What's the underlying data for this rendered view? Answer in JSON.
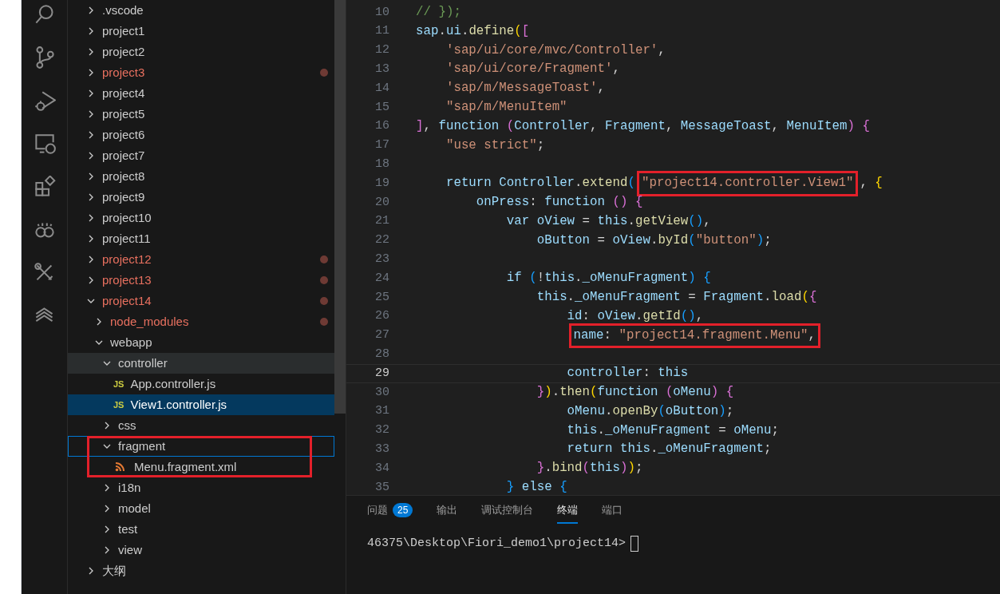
{
  "activity_bar": [
    {
      "kind": "search"
    },
    {
      "kind": "source-control"
    },
    {
      "kind": "run-debug"
    },
    {
      "kind": "remote"
    },
    {
      "kind": "extensions"
    },
    {
      "kind": "loop"
    },
    {
      "kind": "tools"
    },
    {
      "kind": "layers"
    }
  ],
  "explorer": {
    "items": [
      {
        "label": ".vscode",
        "kind": "folder",
        "expanded": false,
        "modified": false,
        "selected": false,
        "hovered": false,
        "focused": false,
        "boxed": false
      },
      {
        "label": "project1",
        "kind": "folder",
        "expanded": false,
        "modified": false,
        "selected": false,
        "hovered": false,
        "focused": false,
        "boxed": false
      },
      {
        "label": "project2",
        "kind": "folder",
        "expanded": false,
        "modified": false,
        "selected": false,
        "hovered": false,
        "focused": false,
        "boxed": false
      },
      {
        "label": "project3",
        "kind": "folder",
        "expanded": false,
        "modified": true,
        "selected": false,
        "hovered": false,
        "focused": false,
        "boxed": false
      },
      {
        "label": "project4",
        "kind": "folder",
        "expanded": false,
        "modified": false,
        "selected": false,
        "hovered": false,
        "focused": false,
        "boxed": false
      },
      {
        "label": "project5",
        "kind": "folder",
        "expanded": false,
        "modified": false,
        "selected": false,
        "hovered": false,
        "focused": false,
        "boxed": false
      },
      {
        "label": "project6",
        "kind": "folder",
        "expanded": false,
        "modified": false,
        "selected": false,
        "hovered": false,
        "focused": false,
        "boxed": false
      },
      {
        "label": "project7",
        "kind": "folder",
        "expanded": false,
        "modified": false,
        "selected": false,
        "hovered": false,
        "focused": false,
        "boxed": false
      },
      {
        "label": "project8",
        "kind": "folder",
        "expanded": false,
        "modified": false,
        "selected": false,
        "hovered": false,
        "focused": false,
        "boxed": false
      },
      {
        "label": "project9",
        "kind": "folder",
        "expanded": false,
        "modified": false,
        "selected": false,
        "hovered": false,
        "focused": false,
        "boxed": false
      },
      {
        "label": "project10",
        "kind": "folder",
        "expanded": false,
        "modified": false,
        "selected": false,
        "hovered": false,
        "focused": false,
        "boxed": false
      },
      {
        "label": "project11",
        "kind": "folder",
        "expanded": false,
        "modified": false,
        "selected": false,
        "hovered": false,
        "focused": false,
        "boxed": false
      },
      {
        "label": "project12",
        "kind": "folder",
        "expanded": false,
        "modified": true,
        "selected": false,
        "hovered": false,
        "focused": false,
        "boxed": false
      },
      {
        "label": "project13",
        "kind": "folder",
        "expanded": false,
        "modified": true,
        "selected": false,
        "hovered": false,
        "focused": false,
        "boxed": false
      },
      {
        "label": "project14",
        "kind": "folder",
        "expanded": true,
        "modified": true,
        "selected": false,
        "hovered": false,
        "focused": false,
        "boxed": false,
        "children": [
          {
            "label": "node_modules",
            "kind": "folder",
            "expanded": false,
            "modified": true,
            "selected": false,
            "hovered": false,
            "focused": false,
            "boxed": false
          },
          {
            "label": "webapp",
            "kind": "folder",
            "expanded": true,
            "modified": false,
            "selected": false,
            "hovered": false,
            "focused": false,
            "boxed": false,
            "children": [
              {
                "label": "controller",
                "kind": "folder",
                "expanded": true,
                "modified": false,
                "selected": false,
                "hovered": true,
                "focused": false,
                "boxed": false,
                "children": [
                  {
                    "label": "App.controller.js",
                    "kind": "js",
                    "icon_text": "JS",
                    "modified": false,
                    "selected": false,
                    "hovered": false,
                    "focused": false,
                    "boxed": false
                  },
                  {
                    "label": "View1.controller.js",
                    "kind": "js",
                    "icon_text": "JS",
                    "modified": false,
                    "selected": true,
                    "hovered": false,
                    "focused": false,
                    "boxed": false
                  }
                ]
              },
              {
                "label": "css",
                "kind": "folder",
                "expanded": false,
                "modified": false,
                "selected": false,
                "hovered": false,
                "focused": false,
                "boxed": false
              },
              {
                "label": "fragment",
                "kind": "folder",
                "expanded": true,
                "modified": false,
                "selected": false,
                "hovered": false,
                "focused": true,
                "boxed": true,
                "children": [
                  {
                    "label": "Menu.fragment.xml",
                    "kind": "xml",
                    "modified": false,
                    "selected": false,
                    "hovered": false,
                    "focused": false,
                    "boxed": true
                  }
                ]
              },
              {
                "label": "i18n",
                "kind": "folder",
                "expanded": false,
                "modified": false,
                "selected": false,
                "hovered": false,
                "focused": false,
                "boxed": false
              },
              {
                "label": "model",
                "kind": "folder",
                "expanded": false,
                "modified": false,
                "selected": false,
                "hovered": false,
                "focused": false,
                "boxed": false
              },
              {
                "label": "test",
                "kind": "folder",
                "expanded": false,
                "modified": false,
                "selected": false,
                "hovered": false,
                "focused": false,
                "boxed": false
              },
              {
                "label": "view",
                "kind": "folder",
                "expanded": false,
                "modified": false,
                "selected": false,
                "hovered": false,
                "focused": false,
                "boxed": false
              }
            ]
          }
        ]
      },
      {
        "label": "大纲",
        "kind": "folder",
        "expanded": false,
        "modified": false,
        "selected": false,
        "hovered": false,
        "focused": false,
        "boxed": false
      }
    ]
  },
  "editor": {
    "lines": [
      {
        "number": "10",
        "current": false,
        "before": "// });"
      },
      {
        "number": "11",
        "current": false,
        "before": "sap.ui.define(["
      },
      {
        "number": "12",
        "current": false,
        "before": "    'sap/ui/core/mvc/Controller',"
      },
      {
        "number": "13",
        "current": false,
        "before": "    'sap/ui/core/Fragment',"
      },
      {
        "number": "14",
        "current": false,
        "before": "    'sap/m/MessageToast',"
      },
      {
        "number": "15",
        "current": false,
        "before": "    \"sap/m/MenuItem\""
      },
      {
        "number": "16",
        "current": false,
        "before": "], function (Controller, Fragment, MessageToast, MenuItem) {"
      },
      {
        "number": "17",
        "current": false,
        "before": "    \"use strict\";"
      },
      {
        "number": "18",
        "current": false
      },
      {
        "number": "19",
        "current": false,
        "before": "    return Controller.extend(",
        "boxed": "\"project14.controller.View1\"",
        "after": ", {"
      },
      {
        "number": "20",
        "current": false,
        "before": "        onPress: function () {"
      },
      {
        "number": "21",
        "current": false,
        "before": "            var oView = this.getView(),"
      },
      {
        "number": "22",
        "current": false,
        "before": "                oButton = oView.byId(\"button\");"
      },
      {
        "number": "23",
        "current": false
      },
      {
        "number": "24",
        "current": false,
        "before": "            if (!this._oMenuFragment) {"
      },
      {
        "number": "25",
        "current": false,
        "before": "                this._oMenuFragment = Fragment.load({"
      },
      {
        "number": "26",
        "current": false,
        "before": "                    id: oView.getId(),"
      },
      {
        "number": "27",
        "current": false,
        "boxed": "                    name: \"project14.fragment.Menu\","
      },
      {
        "number": "28",
        "current": false
      },
      {
        "number": "29",
        "current": true,
        "before": "                    controller: this"
      },
      {
        "number": "30",
        "current": false,
        "before": "                }).then(function (oMenu) {"
      },
      {
        "number": "31",
        "current": false,
        "before": "                    oMenu.openBy(oButton);"
      },
      {
        "number": "32",
        "current": false,
        "before": "                    this._oMenuFragment = oMenu;"
      },
      {
        "number": "33",
        "current": false,
        "before": "                    return this._oMenuFragment;"
      },
      {
        "number": "34",
        "current": false,
        "before": "                }.bind(this));"
      },
      {
        "number": "35",
        "current": false,
        "before": "            } else {"
      }
    ]
  },
  "panel": {
    "tabs": [
      {
        "label": "问题",
        "badge": "25",
        "selected": false
      },
      {
        "label": "输出",
        "selected": false
      },
      {
        "label": "调试控制台",
        "selected": false
      },
      {
        "label": "终端",
        "selected": true
      },
      {
        "label": "端口",
        "selected": false
      }
    ],
    "terminal": {
      "prompt": "46375\\Desktop\\Fiori_demo1\\project14>"
    }
  }
}
